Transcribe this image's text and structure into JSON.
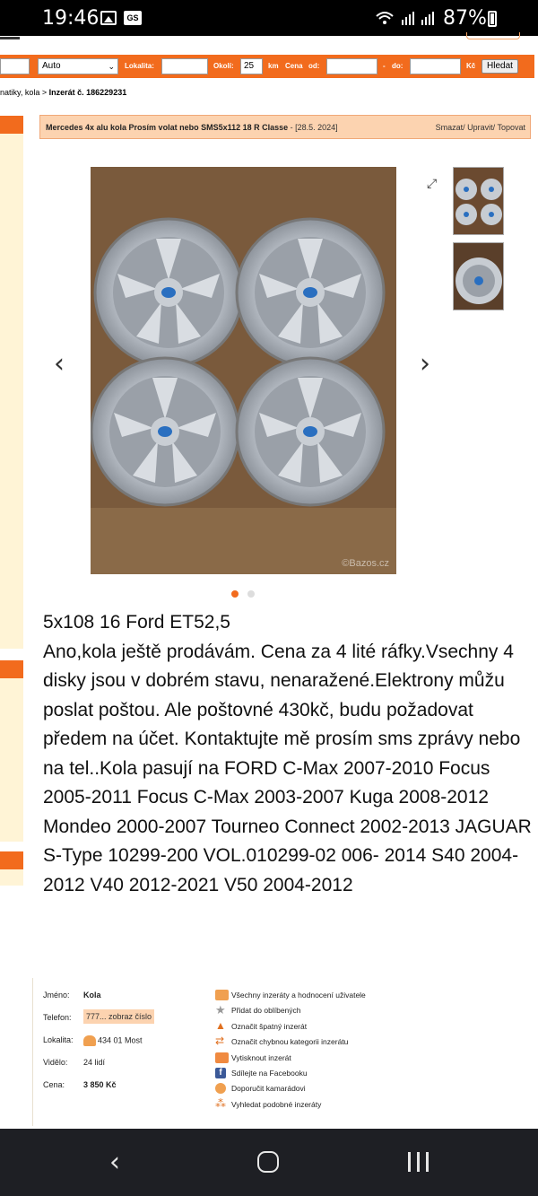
{
  "status_bar": {
    "time": "19:46",
    "battery": "87%",
    "icons": [
      "gallery-icon",
      "gs-icon",
      "wifi-icon",
      "signal-icon",
      "signal-icon",
      "battery-icon"
    ]
  },
  "search": {
    "category_select": "Auto",
    "lokalita_label": "Lokalita:",
    "lokalita_value": "",
    "okoli_label": "Okolí:",
    "okoli_value": "25",
    "km_label": "km",
    "cena_label": "Cena",
    "od_label": "od:",
    "do_sep": "-",
    "do_label": "do:",
    "currency": "Kč",
    "submit_label": "Hledat"
  },
  "breadcrumb": {
    "prefix": "natiky, kola >",
    "current": "Inzerát č. 186229231"
  },
  "ad": {
    "title": "Mercedes 4x alu kola Prosím volat nebo SMS5x112 18 R Classe",
    "date": " - [28.5. 2024]",
    "actions": "Smazat/ Upravit/ Topovat"
  },
  "gallery": {
    "watermark": "©Bazos.cz",
    "photo_count": 2,
    "active_index": 0,
    "colors": {
      "active_dot": "#f26b1d",
      "inactive_dot": "#ddd"
    }
  },
  "description": "5x108 16 Ford ET52,5\nAno,kola ještě prodávám. Cena za 4 lité ráfky.Vsechny 4 disky jsou v dobrém stavu, nenaražené.Elektrony můžu poslat poštou. Ale poštovné 430kč, budu požadovat předem na účet. Kontaktujte mě prosím sms zprávy nebo na tel..Kola pasují na FORD C-Max 2007-2010 Focus 2005-2011 Focus C-Max 2003-2007 Kuga 2008-2012 Mondeo 2000-2007 Tourneo Connect 2002-2013 JAGUAR S-Type 10299-200 VOL.010299-02 006- 2014 S40 2004-2012 V40 2012-2021 V50 2004-2012",
  "details": {
    "name_label": "Jméno:",
    "name_value": "Kola",
    "phone_label": "Telefon:",
    "phone_value": "777... zobraz číslo",
    "location_label": "Lokalita:",
    "location_value": "434 01 Most",
    "views_label": "Vidělo:",
    "views_value": "24 lidí",
    "price_label": "Cena:",
    "price_value": "3 850 Kč"
  },
  "actions": [
    {
      "icon": "user-ads-icon",
      "label": "Všechny inzeráty a hodnocení uživatele"
    },
    {
      "icon": "star-icon",
      "label": "Přidat do oblíbených"
    },
    {
      "icon": "warning-icon",
      "label": "Označit špatný inzerát"
    },
    {
      "icon": "swap-arrows-icon",
      "label": "Označit chybnou kategorii inzerátu"
    },
    {
      "icon": "printer-icon",
      "label": "Vytisknout inzerát"
    },
    {
      "icon": "facebook-icon",
      "label": "Sdílejte na Facebooku"
    },
    {
      "icon": "recommend-icon",
      "label": "Doporučit kamarádovi"
    },
    {
      "icon": "similar-ads-icon",
      "label": "Vyhledat podobné inzeráty"
    }
  ],
  "colors": {
    "accent": "#f26b1d",
    "header_bg": "#fcd3b0",
    "sidebar_cream": "#fff4d6"
  }
}
